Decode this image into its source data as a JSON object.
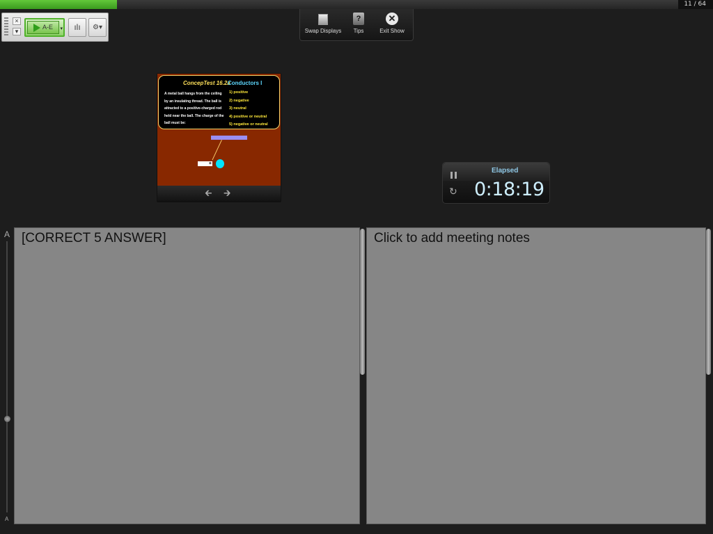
{
  "progress": {
    "fraction": 0.164,
    "counter": "11 / 64"
  },
  "toolbar": {
    "poll_label": "A-E",
    "close_glyph": "×",
    "minimize_glyph": "▾",
    "dropdown_glyph": "▾",
    "results_glyph": "ılı",
    "settings_glyph": "⚙▾"
  },
  "top_menu": {
    "items": [
      {
        "label": "Swap Displays",
        "icon": "swap-displays-icon"
      },
      {
        "label": "Tips",
        "icon": "tips-icon",
        "glyph": "?"
      },
      {
        "label": "Exit Show",
        "icon": "exit-icon",
        "glyph": "✕"
      }
    ]
  },
  "slide": {
    "title": "ConcepTest 16.2a",
    "subtitle": "Conductors I",
    "question": "A metal ball hangs from the ceiling by an insulating thread. The ball is attracted to a positive-charged rod held near the ball. The charge of the ball must be:",
    "options": [
      "1)  positive",
      "2)  negative",
      "3)  neutral",
      "4)  positive or neutral",
      "5)  negative or neutral"
    ],
    "rod_sign": "+",
    "colors": {
      "background": "#882800",
      "title": "#ffe15a",
      "subtitle": "#5ed8ff",
      "options": "#ffe93b",
      "ball": "#00e5ff",
      "rod": "#9a8ef2"
    },
    "nav": {
      "prev": "🡰",
      "next": "🡲"
    }
  },
  "timer": {
    "label": "Elapsed",
    "value": "0:18:19",
    "reset_glyph": "↻"
  },
  "font_rail": {
    "large": "A",
    "small": "A"
  },
  "notes": {
    "presenter_text": "[CORRECT 5 ANSWER]",
    "meeting_placeholder": "Click to add meeting notes"
  }
}
